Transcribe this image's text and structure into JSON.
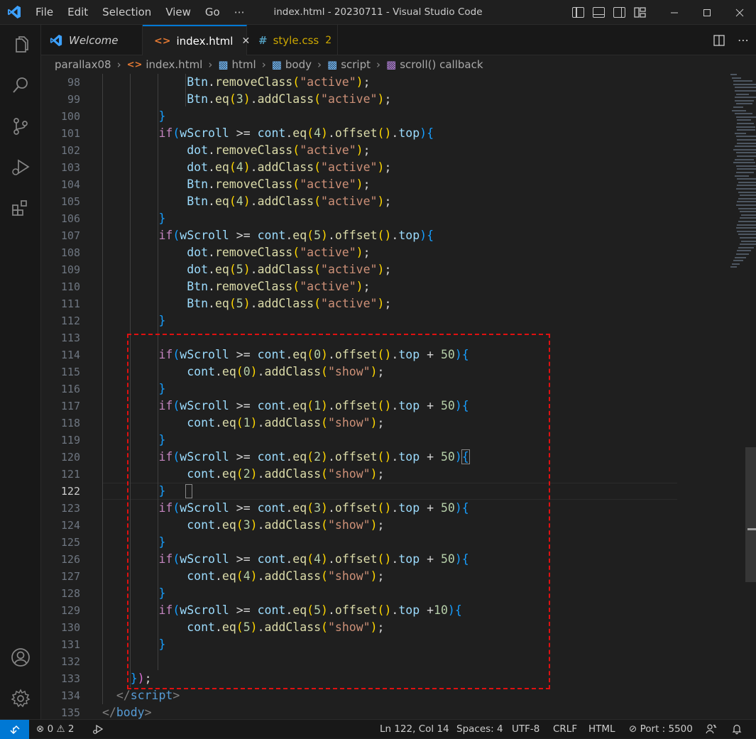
{
  "window": {
    "title": "index.html - 20230711 - Visual Studio Code",
    "menu": [
      "File",
      "Edit",
      "Selection",
      "View",
      "Go",
      "⋯"
    ]
  },
  "tabs": [
    {
      "label": "Welcome",
      "icon": "vscode-logo-icon"
    },
    {
      "label": "index.html",
      "icon": "html-file-icon",
      "close": "✕"
    },
    {
      "label": "style.css",
      "icon": "css-hash-icon",
      "badge": "2"
    }
  ],
  "breadcrumb": [
    "parallax08",
    "index.html",
    "html",
    "body",
    "script",
    "scroll() callback"
  ],
  "editor": {
    "current_line": "122",
    "lines": [
      {
        "n": "98"
      },
      {
        "n": "99"
      },
      {
        "n": "100"
      },
      {
        "n": "101"
      },
      {
        "n": "102"
      },
      {
        "n": "103"
      },
      {
        "n": "104"
      },
      {
        "n": "105"
      },
      {
        "n": "106"
      },
      {
        "n": "107"
      },
      {
        "n": "108"
      },
      {
        "n": "109"
      },
      {
        "n": "110"
      },
      {
        "n": "111"
      },
      {
        "n": "112"
      },
      {
        "n": "113"
      },
      {
        "n": "114"
      },
      {
        "n": "115"
      },
      {
        "n": "116"
      },
      {
        "n": "117"
      },
      {
        "n": "118"
      },
      {
        "n": "119"
      },
      {
        "n": "120"
      },
      {
        "n": "121"
      },
      {
        "n": "122"
      },
      {
        "n": "123"
      },
      {
        "n": "124"
      },
      {
        "n": "125"
      },
      {
        "n": "126"
      },
      {
        "n": "127"
      },
      {
        "n": "128"
      },
      {
        "n": "129"
      },
      {
        "n": "130"
      },
      {
        "n": "131"
      },
      {
        "n": "132"
      },
      {
        "n": "133"
      },
      {
        "n": "134"
      },
      {
        "n": "135"
      }
    ],
    "tokens": {
      "btn": "Btn",
      "dot": "dot",
      "cont": "cont",
      "if": "if",
      "wscroll": "wScroll",
      "remove": "removeClass",
      "add": "addClass",
      "eq": "eq",
      "offset": "offset",
      "top": "top",
      "active": "\"active\"",
      "show": "\"show\"",
      "gte": " >= ",
      "script_close": "script",
      "body_close": "body",
      "closing": "});"
    }
  },
  "status": {
    "errors": "0",
    "warnings": "2",
    "cursor": "Ln 122, Col 14",
    "spaces": "Spaces: 4",
    "encoding": "UTF-8",
    "eol": "CRLF",
    "language": "HTML",
    "port": "Port : 5500"
  },
  "colors": {
    "accent": "#0078d4",
    "highlight_box": "#e01010"
  }
}
